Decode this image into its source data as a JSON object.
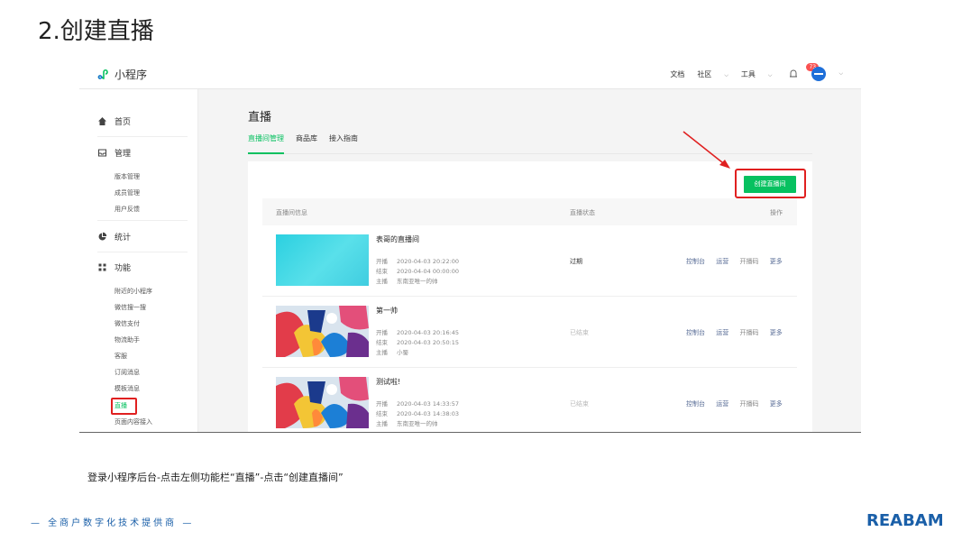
{
  "slide": {
    "title": "2.创建直播"
  },
  "topbar": {
    "brand": "小程序",
    "links": [
      "文档",
      "社区",
      "工具"
    ],
    "notification_count": "73"
  },
  "sidebar": {
    "home": "首页",
    "manage": "管理",
    "manage_items": [
      "版本管理",
      "成员管理",
      "用户反馈"
    ],
    "stats": "统计",
    "features": "功能",
    "feature_items": [
      "附近的小程序",
      "微信搜一搜",
      "微信支付",
      "物流助手",
      "客服",
      "订阅消息",
      "模板消息",
      "直播",
      "页面内容接入"
    ]
  },
  "main": {
    "title": "直播",
    "tabs": [
      "直播间管理",
      "商品库",
      "接入指南"
    ],
    "create_button": "创建直播间",
    "columns": {
      "info": "直播间信息",
      "status": "直播状态",
      "actions": "操作"
    },
    "meta_labels": {
      "start": "开播",
      "end": "结束",
      "host": "主播"
    },
    "rows": [
      {
        "name": "表哥的直播间",
        "start": "2020-04-03 20:22:00",
        "end": "2020-04-04 00:00:00",
        "host": "东南亚唯一的帅",
        "status": "过期",
        "actions": [
          "控制台",
          "运营",
          "开播码",
          "更多"
        ]
      },
      {
        "name": "第一帅",
        "start": "2020-04-03 20:16:45",
        "end": "2020-04-03 20:50:15",
        "host": "小蜀",
        "status": "已结束",
        "actions": [
          "控制台",
          "运营",
          "开播码",
          "更多"
        ]
      },
      {
        "name": "测试啦!",
        "start": "2020-04-03 14:33:57",
        "end": "2020-04-03 14:38:03",
        "host": "东南亚唯一的帅",
        "status": "已结束",
        "actions": [
          "控制台",
          "运营",
          "开播码",
          "更多"
        ]
      }
    ]
  },
  "caption": "登录小程序后台-点击左侧功能栏“直播”-点击“创建直播间”",
  "footer": {
    "tagline": "— 全商户数字化技术提供商 —",
    "logo": "REABAM"
  },
  "colors": {
    "accent_green": "#07c160",
    "highlight_red": "#e02020",
    "link_blue": "#576b95",
    "brand_blue": "#1a5fa8"
  }
}
